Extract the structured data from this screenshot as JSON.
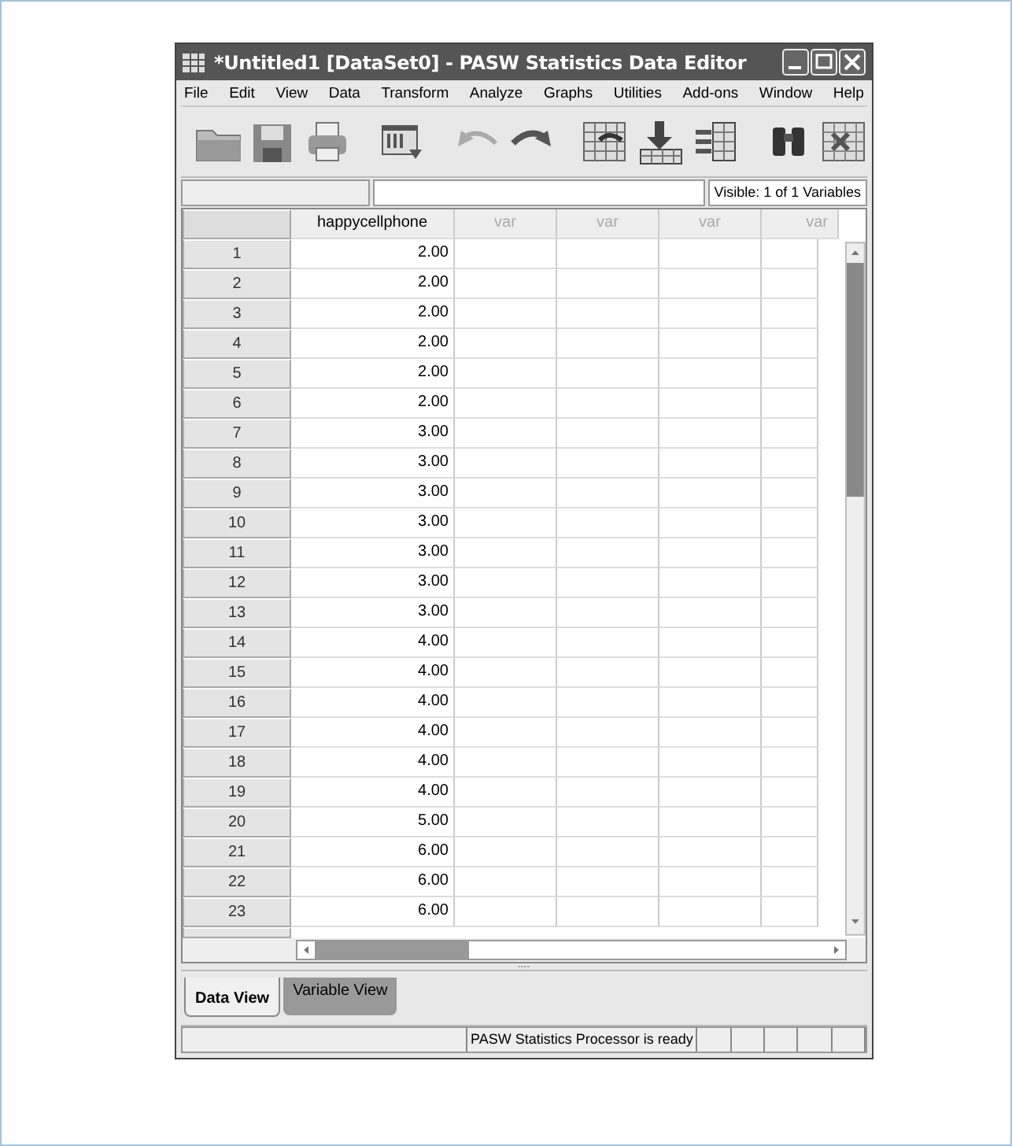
{
  "window": {
    "title": "*Untitled1 [DataSet0] - PASW Statistics Data Editor"
  },
  "menu": [
    "File",
    "Edit",
    "View",
    "Data",
    "Transform",
    "Analyze",
    "Graphs",
    "Utilities",
    "Add-ons",
    "Window",
    "Help"
  ],
  "cell_bar": {
    "visible": "Visible: 1 of 1 Variables"
  },
  "table": {
    "columns": [
      "happycellphone",
      "var",
      "var",
      "var",
      "var"
    ],
    "rows": [
      {
        "n": "1",
        "v": "2.00"
      },
      {
        "n": "2",
        "v": "2.00"
      },
      {
        "n": "3",
        "v": "2.00"
      },
      {
        "n": "4",
        "v": "2.00"
      },
      {
        "n": "5",
        "v": "2.00"
      },
      {
        "n": "6",
        "v": "2.00"
      },
      {
        "n": "7",
        "v": "3.00"
      },
      {
        "n": "8",
        "v": "3.00"
      },
      {
        "n": "9",
        "v": "3.00"
      },
      {
        "n": "10",
        "v": "3.00"
      },
      {
        "n": "11",
        "v": "3.00"
      },
      {
        "n": "12",
        "v": "3.00"
      },
      {
        "n": "13",
        "v": "3.00"
      },
      {
        "n": "14",
        "v": "4.00"
      },
      {
        "n": "15",
        "v": "4.00"
      },
      {
        "n": "16",
        "v": "4.00"
      },
      {
        "n": "17",
        "v": "4.00"
      },
      {
        "n": "18",
        "v": "4.00"
      },
      {
        "n": "19",
        "v": "4.00"
      },
      {
        "n": "20",
        "v": "5.00"
      },
      {
        "n": "21",
        "v": "6.00"
      },
      {
        "n": "22",
        "v": "6.00"
      },
      {
        "n": "23",
        "v": "6.00"
      }
    ]
  },
  "tabs": [
    {
      "label": "Data View",
      "selected": true
    },
    {
      "label": "Variable View",
      "selected": false
    }
  ],
  "status_bar": "PASW Statistics Processor is ready"
}
